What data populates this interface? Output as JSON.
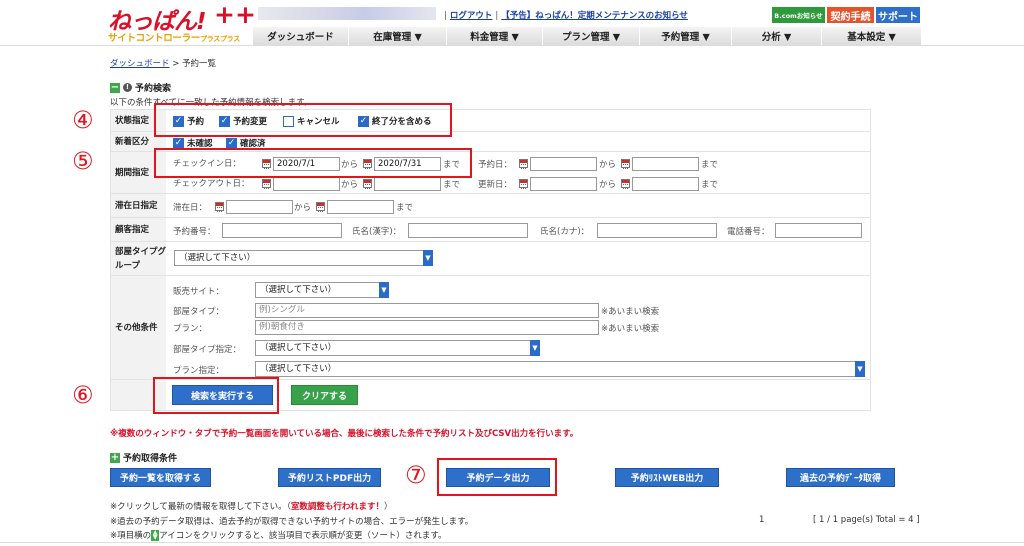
{
  "header": {
    "logo_main": "ねっぱん!",
    "logo_plus": "++",
    "logo_sub": "サイトコントローラー",
    "logo_sub_small": "プラスプラス",
    "logout": "ログアウト",
    "notice": "【予告】ねっぱん！定期メンテナンスのお知らせ",
    "bcom_button": "B.comお知らせ",
    "contract_button": "契約手続",
    "support_button": "サポート"
  },
  "nav": {
    "dashboard": "ダッシュボード",
    "inventory": "在庫管理 ▼",
    "pricing": "料金管理 ▼",
    "plans": "プラン管理 ▼",
    "reservations": "予約管理 ▼",
    "analysis": "分析 ▼",
    "settings": "基本設定 ▼"
  },
  "breadcrumb": {
    "dashboard": "ダッシュボード",
    "separator": " > ",
    "current": "予約一覧"
  },
  "search": {
    "title": "予約検索",
    "note": "以下の条件すべてに一致した予約情報を検索します。",
    "status": {
      "label": "状態指定",
      "reservation": "予約",
      "changed": "予約変更",
      "cancel": "キャンセル",
      "include_finished": "終了分を含める"
    },
    "new_class": {
      "label": "新着区分",
      "unconfirmed": "未確認",
      "confirmed": "確認済"
    },
    "period": {
      "label": "期間指定",
      "checkin": "チェックイン日：",
      "checkin_from": "2020/7/1",
      "checkin_to": "2020/7/31",
      "checkout": "チェックアウト日：",
      "reserve_date": "予約日：",
      "update_date": "更新日：",
      "from": "から",
      "until": "まで"
    },
    "stay": {
      "label": "滞在日指定",
      "stay_date": "滞在日：",
      "from": "から",
      "until": "まで"
    },
    "customer": {
      "label": "顧客指定",
      "reservation_no": "予約番号：",
      "name_kanji": "氏名(漢字)：",
      "name_kana": "氏名(カナ)：",
      "phone": "電話番号："
    },
    "room_group": {
      "label": "部屋タイプグループ",
      "select": "（選択して下さい）"
    },
    "other": {
      "label": "その他条件",
      "site": "販売サイト：",
      "site_select": "（選択して下さい）",
      "room_type": "部屋タイプ：",
      "room_type_placeholder": "例)シングル",
      "plan": "プラン：",
      "plan_placeholder": "例)朝食付き",
      "fuzzy": "※あいまい検索",
      "room_type_spec": "部屋タイプ指定：",
      "room_type_spec_select": "（選択して下さい）",
      "plan_spec": "プラン指定：",
      "plan_spec_select": "（選択して下さい）"
    },
    "execute_button": "検索を実行する",
    "clear_button": "クリアする"
  },
  "warning": "※複数のウィンドウ・タブで予約一覧画面を開いている場合、最後に検索した条件で予約リスト及びCSV出力を行います。",
  "acquire": {
    "title": "予約取得条件",
    "get_list": "予約一覧を取得する",
    "pdf": "予約リストPDF出力",
    "data_out": "予約データ出力",
    "web_out": "予約ﾘｽﾄWEB出力",
    "past": "過去の予約ﾃﾞｰﾀ取得"
  },
  "footnotes": {
    "n1_a": "※クリックして最新の情報を取得して下さい。（",
    "n1_b": "室数調整も行われます！",
    "n1_c": "）",
    "n2": "※過去の予約データ取得は、過去予約が取得できない予約サイトの場合、エラーが発生します。",
    "n3_a": "※項目横の",
    "n3_b": "アイコンをクリックすると、該当項目で表示順が変更（ソート）されます。"
  },
  "pagination": {
    "page": "1",
    "summary": "[ 1 / 1 page(s) Total = 4 ]"
  },
  "annotations": {
    "n4": "④",
    "n5": "⑤",
    "n6": "⑥",
    "n7": "⑦"
  },
  "colors": {
    "brand_red": "#d8102a",
    "accent_blue": "#2e6fc9",
    "green": "#37a24a",
    "highlight_red": "#e4141f"
  }
}
